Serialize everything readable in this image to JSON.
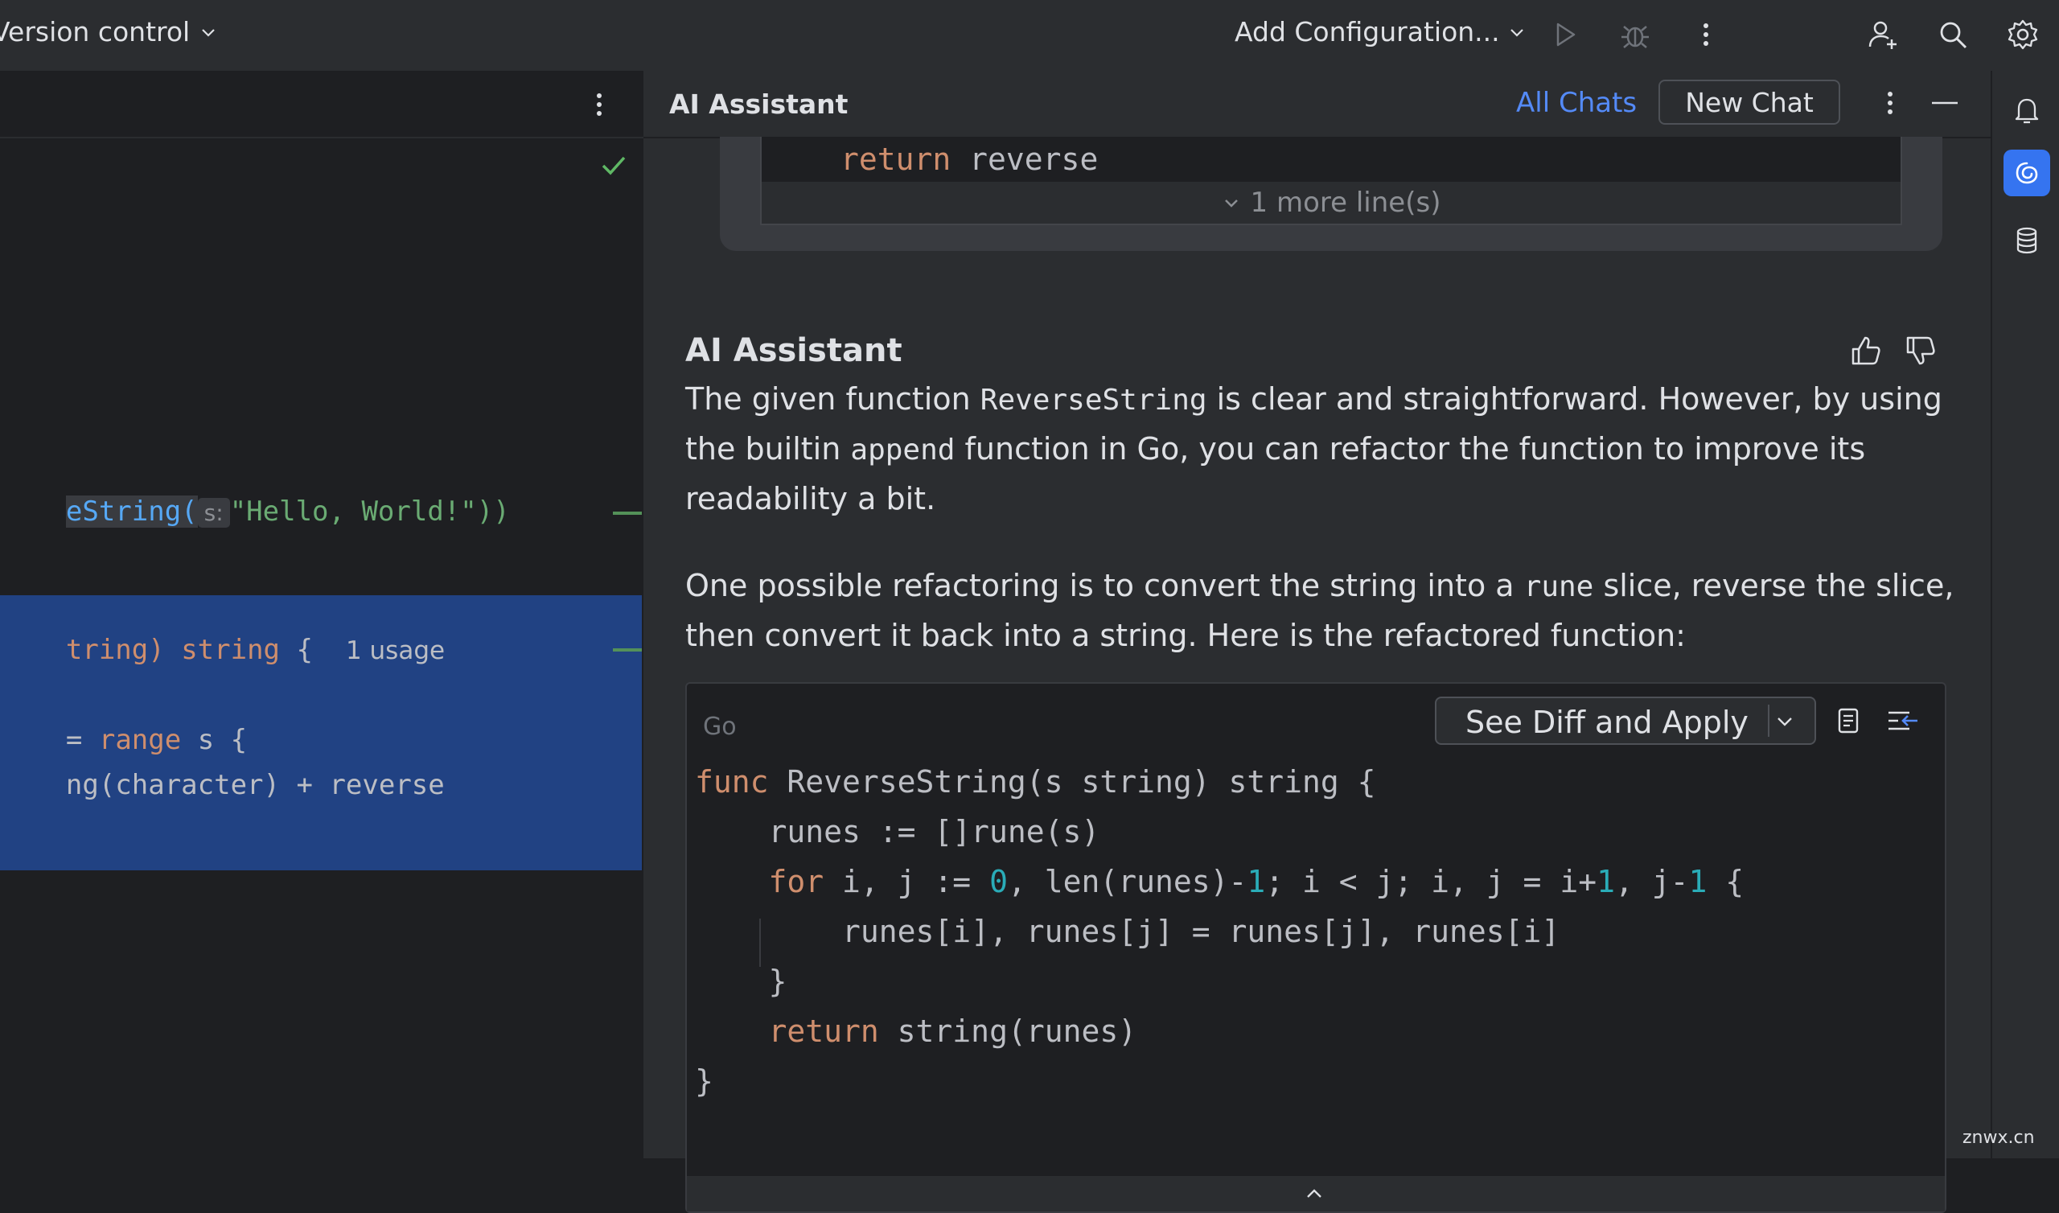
{
  "toolbar": {
    "vcs_label": "Version control",
    "run_config_label": "Add Configuration...",
    "icons": [
      "chevron-down-icon",
      "run-icon",
      "debug-icon",
      "more-icon",
      "add-user-icon",
      "search-icon",
      "settings-icon"
    ]
  },
  "editor": {
    "call_prefix": "eString(",
    "param_hint": "s:",
    "call_arg": "\"Hello, World!\"))",
    "sig_param_tail": "tring)",
    "sig_return": "string",
    "sig_brace": "{",
    "usage_hint": "1 usage",
    "range_line_a": "=",
    "range_kw": "range",
    "range_line_b": "s {",
    "concat_prefix": "ng(character)",
    "concat_op": "+",
    "concat_var": "reverse"
  },
  "ai_panel": {
    "title": "AI Assistant",
    "all_chats": "All Chats",
    "new_chat": "New Chat",
    "prev_block": {
      "return_kw": "return",
      "return_val": "reverse",
      "more_lines": "1 more line(s)"
    },
    "message": {
      "author": "AI Assistant",
      "p1_a": "The given function ",
      "p1_code1": "ReverseString",
      "p1_b": " is clear and straightforward. However, by using the builtin ",
      "p1_code2": "append",
      "p1_c": " function in Go, you can refactor the function to improve its readability a bit.",
      "p2_a": "One possible refactoring is to convert the string into a ",
      "p2_code": "rune",
      "p2_b": " slice, reverse the slice, then convert it back into a string. Here is the refactored function:"
    },
    "code_block": {
      "language": "Go",
      "apply_label": "See Diff and Apply",
      "l1_kw": "func",
      "l1_rest": " ReverseString(s string) string {",
      "l2": "    runes := []rune(s)",
      "l3_kw": "for",
      "l3_a": " i, j := ",
      "l3_n1": "0",
      "l3_b": ", len(runes)-",
      "l3_n2": "1",
      "l3_c": "; i < j; i, j = i+",
      "l3_n3": "1",
      "l3_d": ", j-",
      "l3_n4": "1",
      "l3_e": " {",
      "l4": "        runes[i], runes[j] = runes[j], runes[i]",
      "l5": "    }",
      "l6_kw": "return",
      "l6_rest": " string(runes)",
      "l7": "}"
    }
  },
  "watermark": "znwx.cn"
}
